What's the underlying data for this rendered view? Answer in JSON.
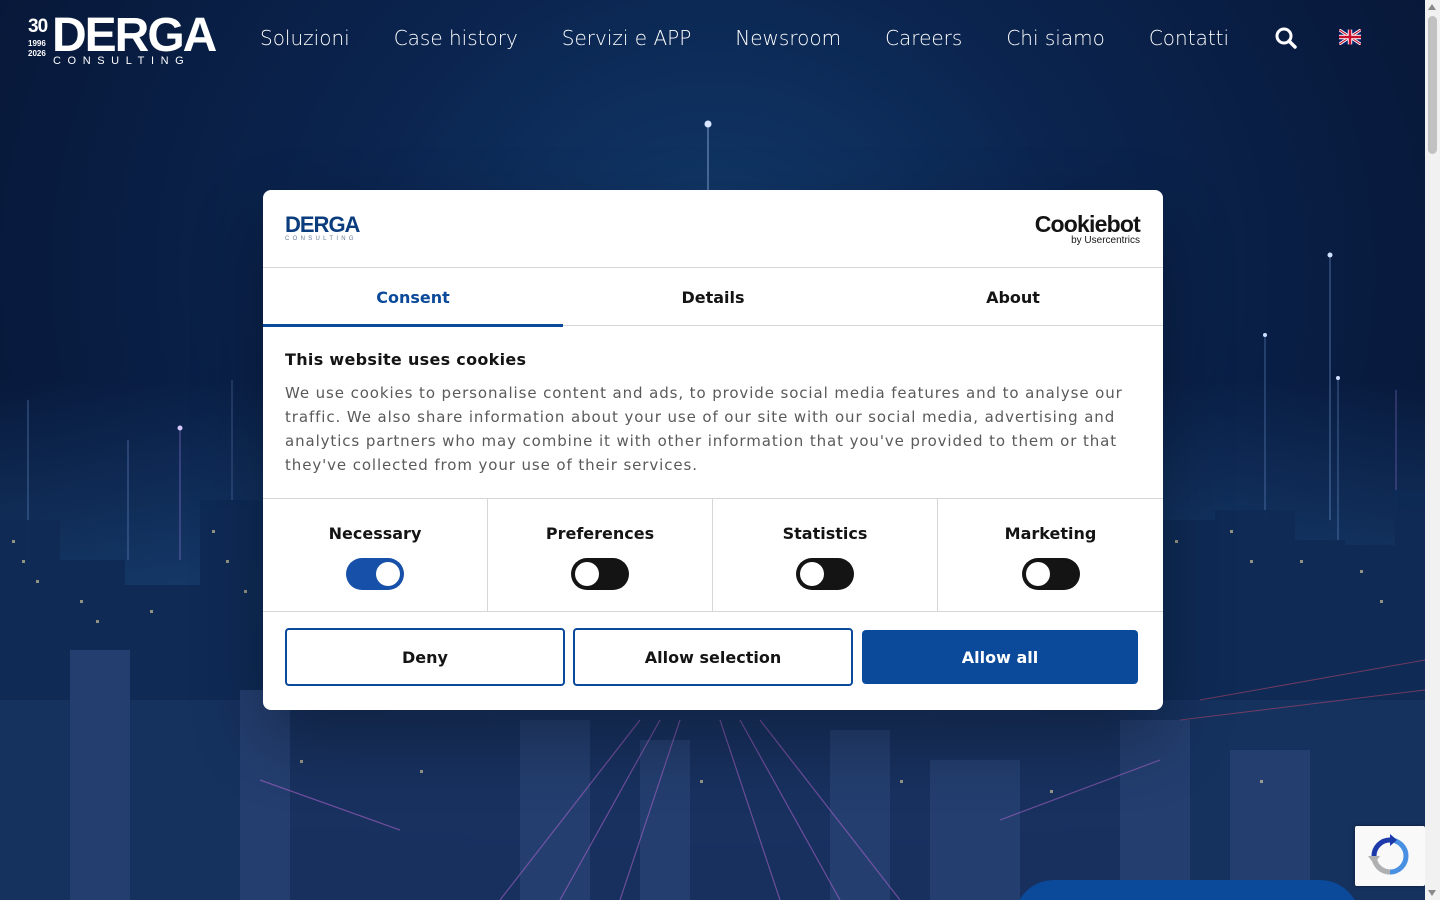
{
  "header": {
    "logo": {
      "anniversary": "30",
      "years": [
        "1996",
        "2026"
      ],
      "brand": "DERGA",
      "sub": "CONSULTING"
    },
    "nav": [
      {
        "label": "Soluzioni"
      },
      {
        "label": "Case history"
      },
      {
        "label": "Servizi e APP"
      },
      {
        "label": "Newsroom"
      },
      {
        "label": "Careers"
      },
      {
        "label": "Chi siamo"
      },
      {
        "label": "Contatti"
      }
    ],
    "search_icon": "search-icon",
    "language_icon": "uk-flag-icon"
  },
  "cookie_dialog": {
    "logo_brand": "DERGA",
    "logo_sub": "CONSULTING",
    "provider": "Cookiebot",
    "provider_sub": "by Usercentrics",
    "tabs": [
      {
        "label": "Consent",
        "active": true
      },
      {
        "label": "Details",
        "active": false
      },
      {
        "label": "About",
        "active": false
      }
    ],
    "title": "This website uses cookies",
    "text": "We use cookies to personalise content and ads, to provide social media features and to analyse our traffic. We also share information about your use of our site with our social media, advertising and analytics partners who may combine it with other information that you've provided to them or that they've collected from your use of their services.",
    "categories": [
      {
        "label": "Necessary",
        "enabled": true
      },
      {
        "label": "Preferences",
        "enabled": false
      },
      {
        "label": "Statistics",
        "enabled": false
      },
      {
        "label": "Marketing",
        "enabled": false
      }
    ],
    "buttons": {
      "deny": "Deny",
      "allow_selection": "Allow selection",
      "allow_all": "Allow all"
    }
  },
  "colors": {
    "accent": "#0b4a9a",
    "hero_bg": "#0b2550"
  }
}
